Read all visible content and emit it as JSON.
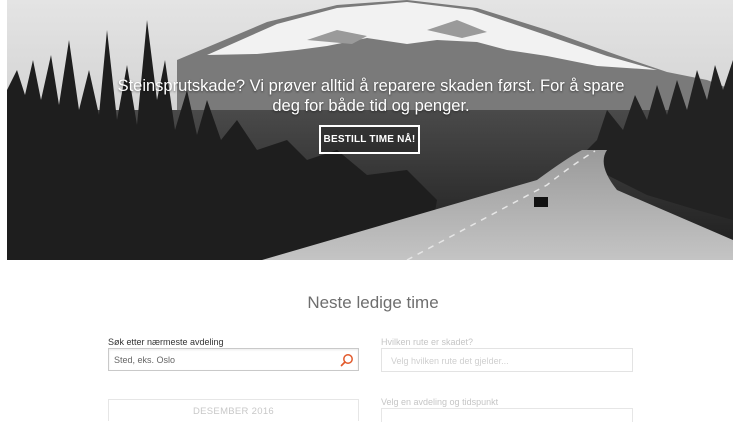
{
  "hero": {
    "text_line1": "Steinsprutskade? Vi prøver alltid å reparere skaden først. For å spare",
    "text_line2": "deg for både tid og penger.",
    "cta_label": "BESTILL TIME NÅ!"
  },
  "booking": {
    "title": "Neste ledige time",
    "search": {
      "label": "Søk etter nærmeste avdeling",
      "placeholder": "Sted, eks. Oslo",
      "icon": "search-icon",
      "icon_color": "#e2592b"
    },
    "route": {
      "label": "Hvilken rute er skadet?",
      "placeholder": "Velg hvilken rute det gjelder..."
    },
    "calendar": {
      "month": "DESEMBER 2016"
    },
    "slot": {
      "label": "Velg en avdeling og tidspunkt"
    }
  }
}
